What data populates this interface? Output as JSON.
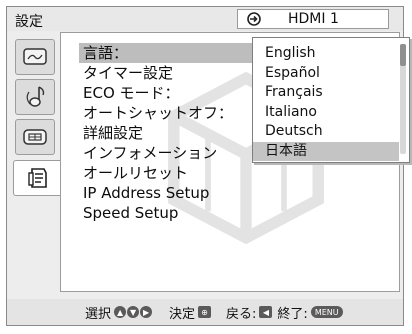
{
  "header": {
    "title": "設定",
    "input_source": "HDMI 1",
    "input_icon": "input-source-icon"
  },
  "tabs": [
    {
      "icon": "picture-settings-icon"
    },
    {
      "icon": "sound-settings-icon"
    },
    {
      "icon": "screen-settings-icon"
    },
    {
      "icon": "setup-settings-icon",
      "active": true
    }
  ],
  "menu": {
    "items": [
      {
        "label": "言語："
      },
      {
        "label": "タイマー設定"
      },
      {
        "label": "ECO モード："
      },
      {
        "label": "オートシャットオフ："
      },
      {
        "label": "詳細設定"
      },
      {
        "label": "インフォメーション"
      },
      {
        "label": "オールリセット"
      },
      {
        "label": "IP Address Setup"
      },
      {
        "label": "Speed Setup"
      }
    ],
    "selected_index": 0
  },
  "language_dropdown": {
    "options": [
      "English",
      "Español",
      "Français",
      "Italiano",
      "Deutsch",
      "日本語"
    ],
    "selected": "日本語"
  },
  "help_bar": {
    "select_label": "選択",
    "enter_label": "決定",
    "back_label": "戻る:",
    "exit_label": "終了:",
    "menu_key": "MENU"
  },
  "colors": {
    "highlight": "#bdbdbd",
    "panel": "#ffffff",
    "frame": "#ededed"
  }
}
